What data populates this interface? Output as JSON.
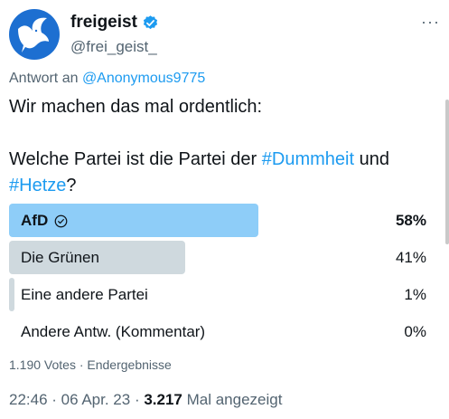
{
  "account": {
    "name": "freigeist",
    "handle": "@frei_geist_",
    "verified": true,
    "avatar_icon": "dove-icon",
    "avatar_color": "#1d6fd1",
    "more_label": "···"
  },
  "reply": {
    "prefix": "Antwort an",
    "mention": "@Anonymous9775"
  },
  "tweet": {
    "line1": "Wir machen das mal ordentlich:",
    "line2_prefix": "Welche Partei ist die Partei der ",
    "hashtag1": "#Dummheit",
    "line2_suffix": " und",
    "hashtag2": "#Hetze",
    "line3_suffix": "?"
  },
  "poll": {
    "options": [
      {
        "label": "AfD",
        "percent": "58%",
        "fraction": 0.58,
        "winner": true,
        "bar_color": "#8ecdf8"
      },
      {
        "label": "Die Grünen",
        "percent": "41%",
        "fraction": 0.41,
        "winner": false,
        "bar_color": "#cfd9de"
      },
      {
        "label": "Eine andere Partei",
        "percent": "1%",
        "fraction": 0.01,
        "winner": false,
        "bar_color": "#cfd9de"
      },
      {
        "label": "Andere Antw. (Kommentar)",
        "percent": "0%",
        "fraction": 0.0,
        "winner": false,
        "bar_color": "#cfd9de"
      }
    ],
    "summary": "1.190 Votes · Endergebnisse"
  },
  "meta": {
    "time": "22:46 · 06 Apr. 23 · ",
    "views": "3.217",
    "views_label": " Mal angezeigt"
  },
  "colors": {
    "link": "#1d9bf0",
    "secondary_text": "#536471",
    "verified_badge": "#1d9bf0"
  }
}
